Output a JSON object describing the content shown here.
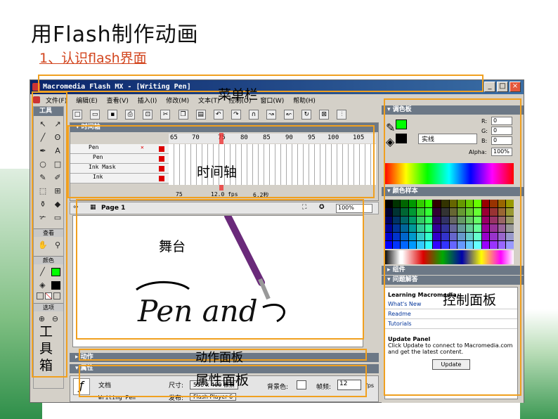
{
  "slide": {
    "title": "用Flash制作动画",
    "subtitle": "1、认识flash界面"
  },
  "window": {
    "title": "Macromedia Flash MX - [Writing Pen]",
    "controls": [
      "_",
      "□",
      "×"
    ]
  },
  "menubar": {
    "items": [
      "文件(F)",
      "编辑(E)",
      "查看(V)",
      "插入(I)",
      "修改(M)",
      "文本(T)",
      "控制(O)",
      "窗口(W)",
      "帮助(H)"
    ]
  },
  "tools": {
    "header": "工具",
    "section_view": "查看",
    "section_colors": "颜色",
    "section_options": "选项",
    "icons": [
      "arrow-icon",
      "subselect-icon",
      "line-icon",
      "lasso-icon",
      "pen-icon",
      "text-icon",
      "oval-icon",
      "rect-icon",
      "pencil-icon",
      "brush-icon",
      "free-transform-icon",
      "fill-transform-icon",
      "ink-bottle-icon",
      "paint-bucket-icon",
      "eyedropper-icon",
      "eraser-icon"
    ],
    "glyphs": [
      "↖",
      "↗",
      "╱",
      "ʘ",
      "✒",
      "A",
      "○",
      "□",
      "✎",
      "✐",
      "⬚",
      "⊞",
      "⚱",
      "◆",
      "✃",
      "▭"
    ]
  },
  "timeline": {
    "header": "时间轴",
    "ruler": [
      "65",
      "70",
      "75",
      "80",
      "85",
      "90",
      "95",
      "100",
      "105"
    ],
    "layers": [
      "Pen",
      "Pen",
      "Ink Mask",
      "Ink"
    ],
    "current_frame": "75",
    "fps": "12.0 fps",
    "time": "6.2秒"
  },
  "editbar": {
    "scene": "Page 1",
    "zoom": "100%"
  },
  "stage": {
    "artwork_text": "Pen and"
  },
  "color_mixer": {
    "header": "调色板",
    "R": "0",
    "G": "0",
    "B": "0",
    "alpha_label": "Alpha:",
    "alpha": "100%",
    "fill_type": "实线"
  },
  "swatches": {
    "header": "颜色样本"
  },
  "components": {
    "header": "组件"
  },
  "answers": {
    "header": "问题解答",
    "learning": "Learning Macromedia",
    "links": [
      "What's New",
      "Readme",
      "Tutorials"
    ],
    "update_title": "Update Panel",
    "update_desc": "Click Update to connect to Macromedia.com and get the latest content.",
    "update_button": "Update"
  },
  "actions": {
    "header": "动作"
  },
  "properties": {
    "header": "属性",
    "doc_label": "文档",
    "doc_name": "Writing Pen",
    "size_label": "尺寸:",
    "size_value": "550 x 400 像素",
    "publish_label": "发布:",
    "publish_value": "Flash Player 6",
    "bg_label": "背景色:",
    "fps_label": "帧频:",
    "fps_value": "12",
    "fps_unit": "fps"
  },
  "annotations": {
    "menubar": "菜单栏",
    "timeline": "时间轴",
    "stage": "舞台",
    "toolbox": "工具箱",
    "actions": "动作面板",
    "properties": "属性面板",
    "control_panels": "控制面板"
  },
  "colors": {
    "highlight": "#f0a020",
    "subtitle": "#d2451e",
    "titlebar": "#0a246a"
  }
}
